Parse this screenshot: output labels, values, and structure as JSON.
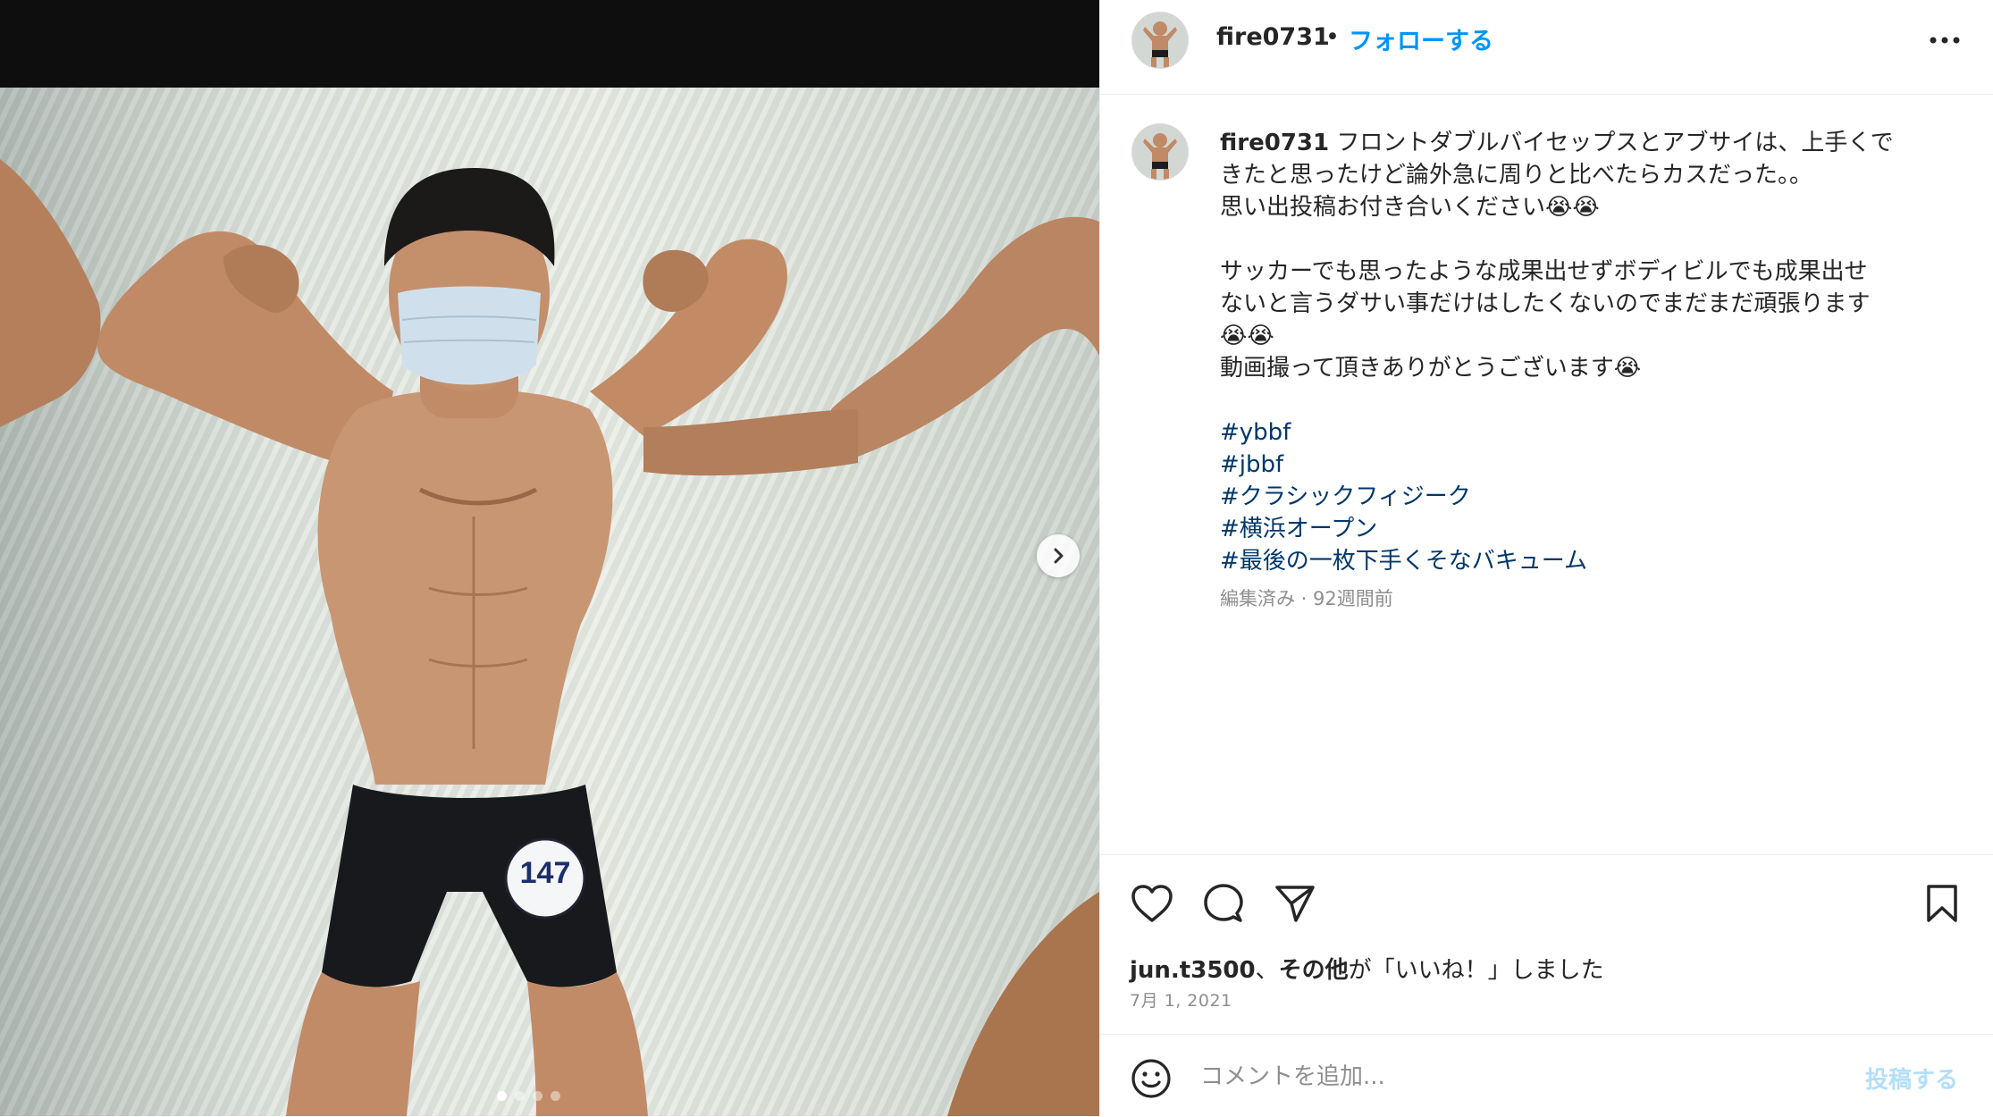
{
  "post": {
    "username": "fire0731",
    "follow_label": "フォローする",
    "bullet": "•",
    "more_icon": "more-horizontal-icon",
    "caption": {
      "lines": [
        "フロントダブルバイセップスとアブサイは、上手くで",
        "きたと思ったけど論外急に周りと比べたらカスだった。。",
        "思い出投稿お付き合いください😭😭",
        "",
        "サッカーでも思ったような成果出せずボディビルでも成果出せ",
        "ないと言うダサい事だけはしたくないのでまだまだ頑張ります",
        "😭😭",
        "動画撮って頂きありがとうございます😭",
        ""
      ],
      "hashtags": [
        "#ybbf",
        "#jbbf",
        "#クラシックフィジーク",
        "#横浜オープン",
        "#最後の一枚下手くそなバキューム"
      ],
      "meta": "編集済み · 92週間前"
    },
    "carousel": {
      "badge_number": "147",
      "slide_count": 4,
      "active_slide": 1
    },
    "likes": {
      "user": "jun.t3500",
      "sep": "、",
      "others": "その他",
      "suffix": "が「いいね！」しました"
    },
    "date": "7月 1, 2021",
    "comment": {
      "placeholder": "コメントを追加...",
      "post_label": "投稿する"
    }
  },
  "colors": {
    "link_blue": "#0095f6",
    "hashtag": "#00376b",
    "muted": "#8e8e8e",
    "post_disabled": "#b2dffc"
  }
}
